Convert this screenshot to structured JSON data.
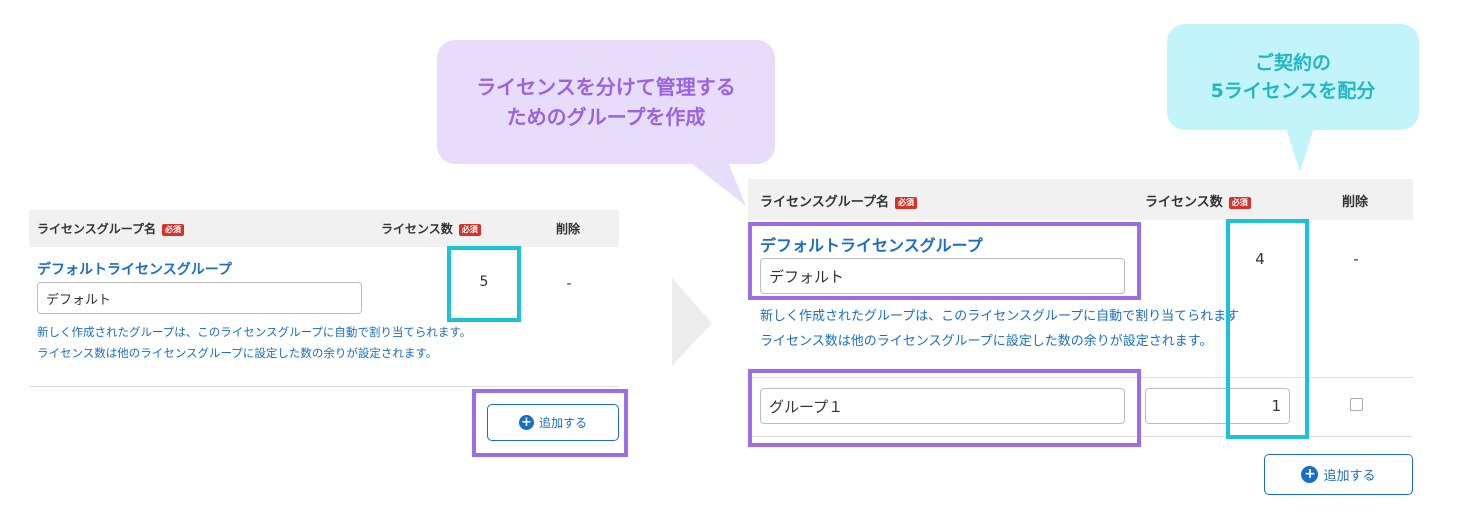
{
  "callouts": {
    "create_group": {
      "line1": "ライセンスを分けて管理する",
      "line2": "ためのグループを作成"
    },
    "allocate": {
      "line1": "ご契約の",
      "line2": "5ライセンスを配分"
    }
  },
  "before": {
    "headers": {
      "group_name": "ライセンスグループ名",
      "required": "必須",
      "license_count": "ライセンス数",
      "delete": "削除"
    },
    "default_group": {
      "title": "デフォルトライセンスグループ",
      "name_value": "デフォルト",
      "license_count": "5",
      "delete": "-"
    },
    "notes": {
      "line1": "新しく作成されたグループは、このライセンスグループに自動で割り当てられます。",
      "line2": "ライセンス数は他のライセンスグループに設定した数の余りが設定されます。"
    },
    "add_button": "追加する"
  },
  "after": {
    "headers": {
      "group_name": "ライセンスグループ名",
      "required": "必須",
      "license_count": "ライセンス数",
      "delete": "削除"
    },
    "default_group": {
      "title": "デフォルトライセンスグループ",
      "name_value": "デフォルト",
      "license_count": "4",
      "delete": "-"
    },
    "notes": {
      "line1": "新しく作成されたグループは、このライセンスグループに自動で割り当てられます",
      "line2": "ライセンス数は他のライセンスグループに設定した数の余りが設定されます。"
    },
    "new_group": {
      "name_value": "グループ１",
      "license_count": "1"
    },
    "add_button": "追加する"
  },
  "colors": {
    "purple_highlight": "#9b6ee8",
    "cyan_highlight": "#1bc3d4",
    "link_blue": "#1a6ec8",
    "required_red": "#d9302a",
    "bubble_purple": "#e7ddfa",
    "bubble_cyan": "#c3f4fa"
  },
  "icons": {
    "add": "plus-circle-icon",
    "arrow": "chevron-right-arrow-icon"
  }
}
